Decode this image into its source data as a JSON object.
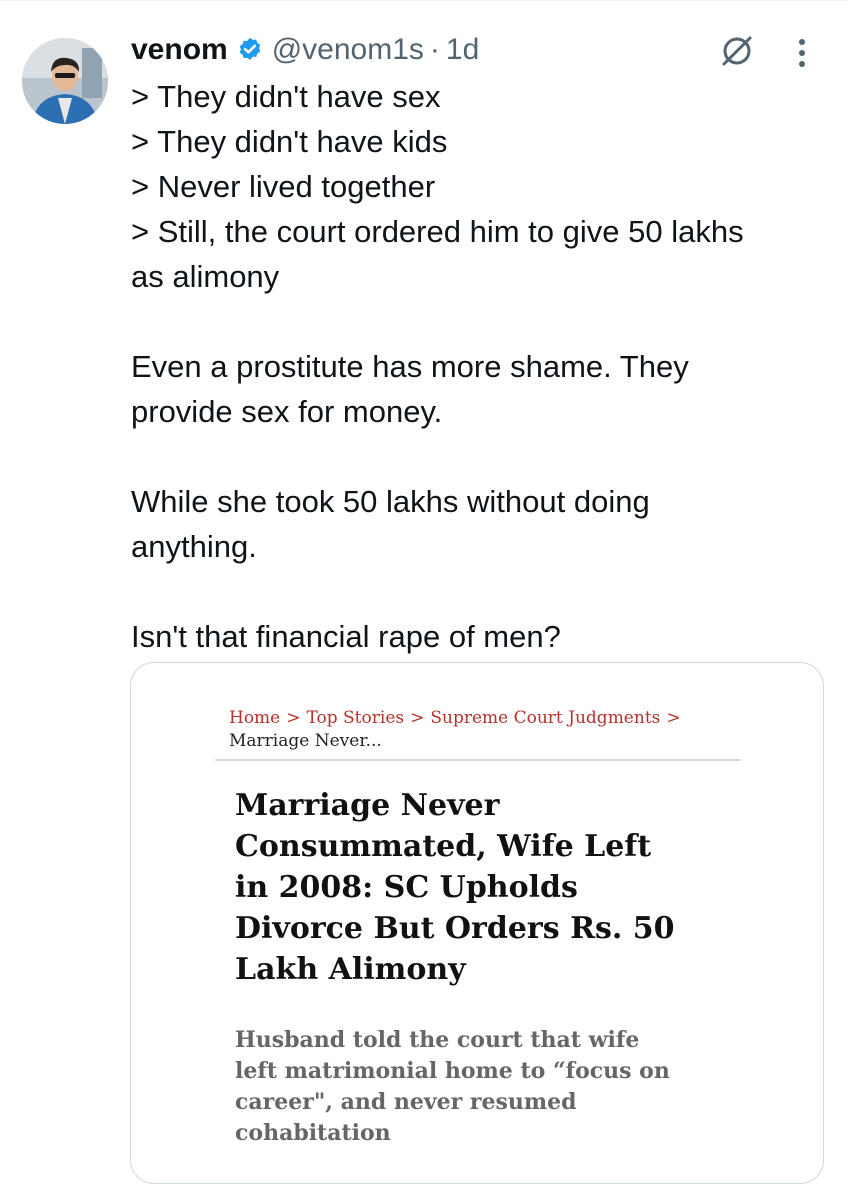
{
  "tweet": {
    "author": {
      "display_name": "venom",
      "handle": "@venom1s",
      "verified": true,
      "avatar_icon": "avatar-photo"
    },
    "separator": "·",
    "time": "1d",
    "actions": {
      "grok_icon": "grok-slash-icon",
      "more_icon": "more-vertical-icon"
    },
    "text": {
      "lines": [
        "> They didn't have sex",
        "> They didn't have kids",
        "> Never lived together",
        "> Still, the court ordered him to give 50 lakhs",
        "as alimony"
      ],
      "para2": [
        "Even a prostitute has more shame. They",
        "provide sex for money."
      ],
      "para3": [
        "While she took 50 lakhs without doing",
        "anything."
      ],
      "para4": [
        "Isn't that financial rape of men?"
      ]
    }
  },
  "card": {
    "breadcrumb": {
      "items": [
        "Home",
        "Top Stories",
        "Supreme Court Judgments"
      ],
      "separator": ">",
      "current": "Marriage Never..."
    },
    "headline_lines": [
      "Marriage Never",
      "Consummated, Wife Left",
      "in 2008: SC Upholds",
      "Divorce But Orders Rs. 50",
      "Lakh Alimony"
    ],
    "subhead_lines": [
      "Husband told the court that wife",
      "left matrimonial home to “focus on",
      "career\", and never resumed",
      "cohabitation"
    ]
  },
  "colors": {
    "text_primary": "#0f1419",
    "text_secondary": "#536471",
    "verified_blue": "#1d9bf0",
    "breadcrumb_red": "#b5312c",
    "card_border": "#cfd9de"
  }
}
